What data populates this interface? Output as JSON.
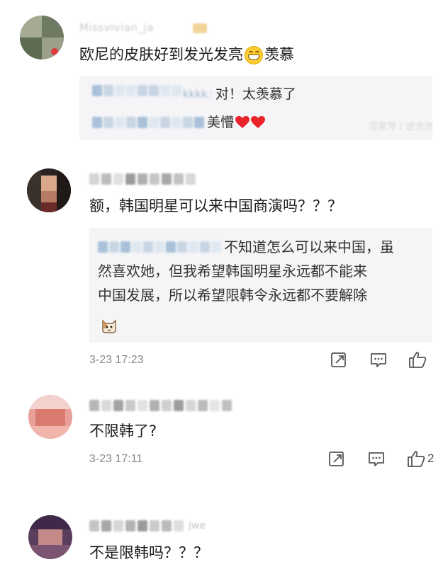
{
  "comments": [
    {
      "username": "Missvivian_ja",
      "text": "欧尼的皮肤好到发光发亮",
      "text_suffix": "羡慕",
      "emoji": "grinning-face-icon",
      "replies": [
        {
          "user": "kkkk",
          "text": "对！太羡慕了"
        },
        {
          "user": "",
          "text": "美懵"
        }
      ],
      "watermark": "百家号 / 逆流流"
    },
    {
      "username": "",
      "text": "额，韩国明星可以来中国商演吗？？？",
      "replies": [
        {
          "user": "",
          "text": "不知道怎么可以来中国，虽",
          "text2": "然喜欢她，但我希望韩国明星永远都不能来",
          "text3": "中国发展，所以希望限韩令永远都不要解除"
        }
      ],
      "time": "3-23 17:23"
    },
    {
      "username": "",
      "text": "不限韩了?",
      "time": "3-23 17:11"
    },
    {
      "username": "jwe",
      "text": "不是限韩吗？？？"
    }
  ],
  "icons": {
    "share": "share-icon",
    "comment": "comment-icon",
    "like": "thumbs-up-icon"
  },
  "colors": {
    "reply_bg": "#f5f5f7",
    "heart": "#e8242a",
    "link_blue": "#a9c1d9",
    "meta_gray": "#8a8a8a"
  }
}
